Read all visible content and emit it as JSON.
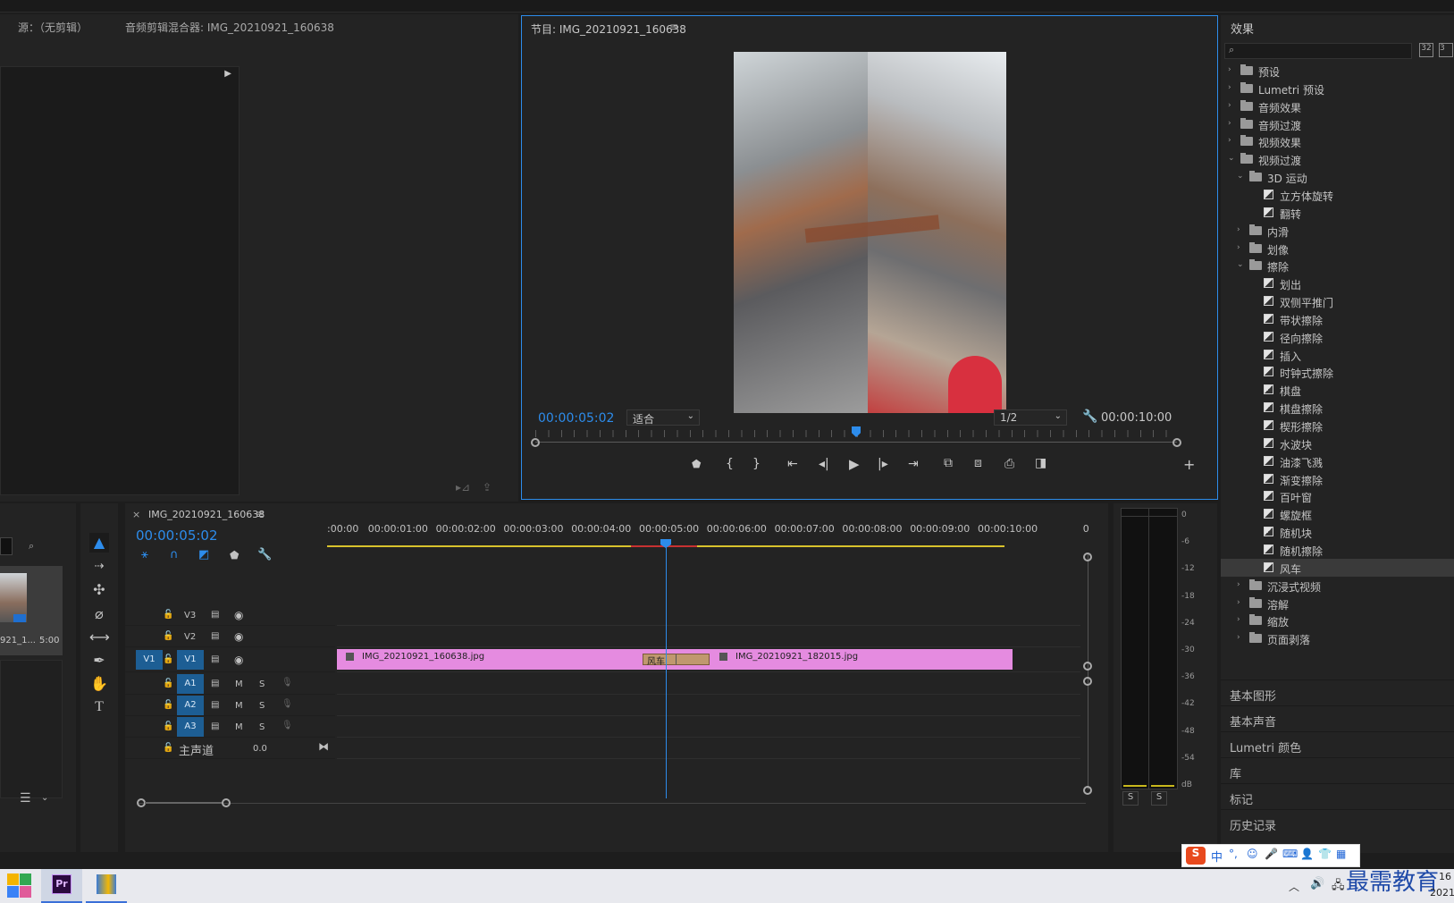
{
  "source_panel": {
    "tab_source": "源：（无剪辑）",
    "tab_mixer": "音频剪辑混合器: IMG_20210921_160638"
  },
  "program": {
    "title": "节目: IMG_20210921_160638",
    "current_time": "00:00:05:02",
    "fit_label": "适合",
    "resolution": "1/2",
    "duration": "00:00:10:00",
    "playhead_progress": 0.5
  },
  "effects": {
    "title": "效果",
    "search_placeholder": "",
    "tree": [
      {
        "label": "预设",
        "level": 0,
        "type": "preset",
        "expanded": false
      },
      {
        "label": "Lumetri 预设",
        "level": 0,
        "type": "preset",
        "expanded": false
      },
      {
        "label": "音频效果",
        "level": 0,
        "type": "folder",
        "expanded": false
      },
      {
        "label": "音频过渡",
        "level": 0,
        "type": "folder",
        "expanded": false
      },
      {
        "label": "视频效果",
        "level": 0,
        "type": "folder",
        "expanded": false
      },
      {
        "label": "视频过渡",
        "level": 0,
        "type": "folder",
        "expanded": true
      },
      {
        "label": "3D 运动",
        "level": 1,
        "type": "folder",
        "expanded": true
      },
      {
        "label": "立方体旋转",
        "level": 2,
        "type": "fx"
      },
      {
        "label": "翻转",
        "level": 2,
        "type": "fx"
      },
      {
        "label": "内滑",
        "level": 1,
        "type": "folder",
        "expanded": false
      },
      {
        "label": "划像",
        "level": 1,
        "type": "folder",
        "expanded": false
      },
      {
        "label": "擦除",
        "level": 1,
        "type": "folder",
        "expanded": true
      },
      {
        "label": "划出",
        "level": 2,
        "type": "fx"
      },
      {
        "label": "双侧平推门",
        "level": 2,
        "type": "fx"
      },
      {
        "label": "带状擦除",
        "level": 2,
        "type": "fx"
      },
      {
        "label": "径向擦除",
        "level": 2,
        "type": "fx"
      },
      {
        "label": "插入",
        "level": 2,
        "type": "fx"
      },
      {
        "label": "时钟式擦除",
        "level": 2,
        "type": "fx"
      },
      {
        "label": "棋盘",
        "level": 2,
        "type": "fx"
      },
      {
        "label": "棋盘擦除",
        "level": 2,
        "type": "fx"
      },
      {
        "label": "楔形擦除",
        "level": 2,
        "type": "fx"
      },
      {
        "label": "水波块",
        "level": 2,
        "type": "fx"
      },
      {
        "label": "油漆飞溅",
        "level": 2,
        "type": "fx"
      },
      {
        "label": "渐变擦除",
        "level": 2,
        "type": "fx"
      },
      {
        "label": "百叶窗",
        "level": 2,
        "type": "fx"
      },
      {
        "label": "螺旋框",
        "level": 2,
        "type": "fx"
      },
      {
        "label": "随机块",
        "level": 2,
        "type": "fx"
      },
      {
        "label": "随机擦除",
        "level": 2,
        "type": "fx"
      },
      {
        "label": "风车",
        "level": 2,
        "type": "fx",
        "selected": true
      },
      {
        "label": "沉浸式视频",
        "level": 1,
        "type": "folder",
        "expanded": false
      },
      {
        "label": "溶解",
        "level": 1,
        "type": "folder",
        "expanded": false
      },
      {
        "label": "缩放",
        "level": 1,
        "type": "folder",
        "expanded": false
      },
      {
        "label": "页面剥落",
        "level": 1,
        "type": "folder",
        "expanded": false
      }
    ],
    "sections": [
      "基本图形",
      "基本声音",
      "Lumetri 颜色",
      "库",
      "标记",
      "历史记录"
    ]
  },
  "project": {
    "clip_name": "921_1...",
    "clip_duration": "5:00"
  },
  "timeline": {
    "tab": "IMG_20210921_160638",
    "close": "×",
    "current_time": "00:00:05:02",
    "ruler": [
      ":00:00",
      "00:00:01:00",
      "00:00:02:00",
      "00:00:03:00",
      "00:00:04:00",
      "00:00:05:00",
      "00:00:06:00",
      "00:00:07:00",
      "00:00:08:00",
      "00:00:09:00",
      "00:00:10:00",
      "0"
    ],
    "tracks_video": [
      "V3",
      "V2",
      "V1"
    ],
    "tracks_audio": [
      "A1",
      "A2",
      "A3"
    ],
    "source_patch_v": "V1",
    "master_label": "主声道",
    "master_value": "0.0",
    "mute": "M",
    "solo": "S",
    "clip1": "IMG_20210921_160638.jpg",
    "clip2": "IMG_20210921_182015.jpg",
    "transition": "风车",
    "clip_color": "#e58be0"
  },
  "meters": {
    "scale": [
      "0",
      "-6",
      "-12",
      "-18",
      "-24",
      "-30",
      "-36",
      "-42",
      "-48",
      "-54",
      "dB"
    ],
    "solo_left": "S",
    "solo_right": "S"
  },
  "taskbar": {
    "premiere_label": "Pr",
    "ime_label": "中",
    "watermark": "最需教育",
    "clock_top": "16",
    "clock_bottom": "2021"
  }
}
